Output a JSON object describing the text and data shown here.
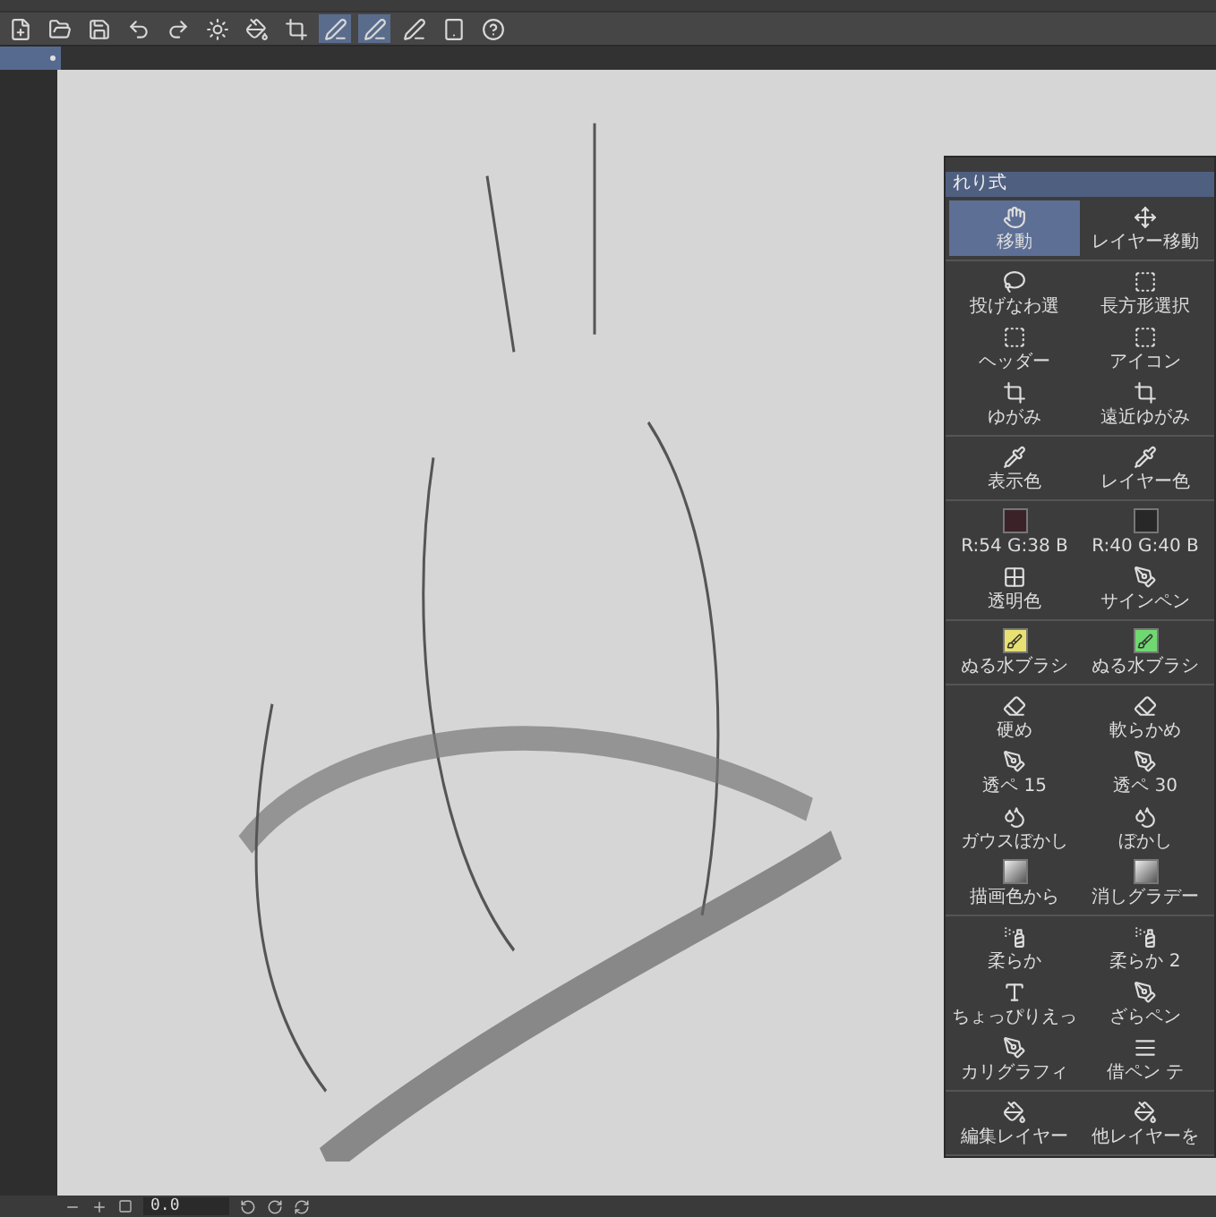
{
  "toolbar": [
    {
      "kind": "new",
      "selected": false
    },
    {
      "kind": "open",
      "selected": false
    },
    {
      "kind": "save",
      "selected": false
    },
    {
      "kind": "undo",
      "selected": false
    },
    {
      "kind": "redo",
      "selected": false
    },
    {
      "kind": "clear",
      "selected": false
    },
    {
      "kind": "fill",
      "selected": false
    },
    {
      "kind": "crop",
      "selected": false
    },
    {
      "kind": "ruler",
      "selected": true
    },
    {
      "kind": "ruler",
      "selected": true
    },
    {
      "kind": "ruler",
      "selected": false
    },
    {
      "kind": "device",
      "selected": false
    },
    {
      "kind": "help",
      "selected": false
    }
  ],
  "panel": {
    "title": "れり式",
    "groups": [
      [
        {
          "label": "移動",
          "kind": "hand",
          "selected": true
        },
        {
          "label": "レイヤー移動",
          "kind": "move",
          "selected": false
        }
      ],
      [
        {
          "label": "投げなわ選",
          "kind": "lasso",
          "selected": false
        },
        {
          "label": "長方形選択",
          "kind": "rect",
          "selected": false
        },
        {
          "label": "ヘッダー",
          "kind": "rect",
          "selected": false
        },
        {
          "label": "アイコン",
          "kind": "rect",
          "selected": false
        },
        {
          "label": "ゆがみ",
          "kind": "crop",
          "selected": false
        },
        {
          "label": "遠近ゆがみ",
          "kind": "crop",
          "selected": false
        }
      ],
      [
        {
          "label": "表示色",
          "kind": "eyedropper",
          "selected": false
        },
        {
          "label": "レイヤー色",
          "kind": "eyedropper",
          "selected": false
        }
      ],
      [
        {
          "label": "R:54 G:38 B",
          "kind": "swatch",
          "color": "#3a2228",
          "selected": false
        },
        {
          "label": "R:40 G:40 B",
          "kind": "swatch",
          "color": "#282828",
          "selected": false
        },
        {
          "label": "透明色",
          "kind": "checker",
          "selected": false
        },
        {
          "label": "サインペン",
          "kind": "pen",
          "selected": false
        }
      ],
      [
        {
          "label": "ぬる水ブラシ",
          "kind": "water",
          "color": "#e8e070",
          "selected": false
        },
        {
          "label": "ぬる水ブラシ",
          "kind": "water",
          "color": "#70d870",
          "selected": false
        }
      ],
      [
        {
          "label": "硬め",
          "kind": "eraser",
          "selected": false
        },
        {
          "label": "軟らかめ",
          "kind": "eraser",
          "selected": false
        },
        {
          "label": "透ペ 15",
          "kind": "pen",
          "selected": false
        },
        {
          "label": "透ペ 30",
          "kind": "pen",
          "selected": false
        },
        {
          "label": "ガウスぼかし",
          "kind": "drop",
          "selected": false
        },
        {
          "label": "ぼかし",
          "kind": "drop",
          "selected": false
        },
        {
          "label": "描画色から",
          "kind": "gradient",
          "selected": false
        },
        {
          "label": "消しグラデー",
          "kind": "gradient",
          "selected": false
        }
      ],
      [
        {
          "label": "柔らか",
          "kind": "airbrush",
          "selected": false
        },
        {
          "label": "柔らか 2",
          "kind": "airbrush",
          "selected": false
        },
        {
          "label": "ちょっぴりえっ",
          "kind": "text",
          "selected": false
        },
        {
          "label": "ざらペン",
          "kind": "pen",
          "selected": false
        },
        {
          "label": "カリグラフィ",
          "kind": "pen",
          "selected": false
        },
        {
          "label": "借ペン テ",
          "kind": "lines",
          "selected": false
        }
      ],
      [
        {
          "label": "編集レイヤー",
          "kind": "fill",
          "selected": false
        },
        {
          "label": "他レイヤーを",
          "kind": "fill",
          "selected": false
        }
      ]
    ]
  },
  "status_bar": {
    "zoom_value": "0.0"
  }
}
